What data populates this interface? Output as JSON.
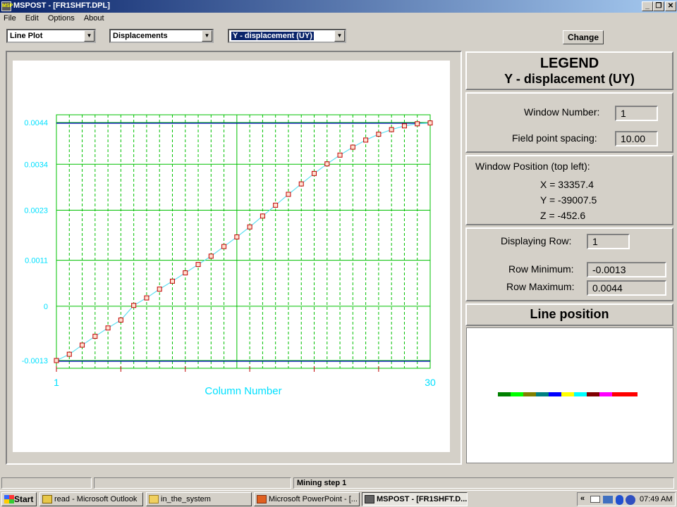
{
  "window": {
    "title": "MSPOST - [FR1SHFT.DPL]",
    "icon_text": "MSP"
  },
  "menu": [
    "File",
    "Edit",
    "Options",
    "About"
  ],
  "toolbar": {
    "plot_type": "Line Plot",
    "result_type": "Displacements",
    "component": "Y - displacement (UY)",
    "change_label": "Change"
  },
  "chart_data": {
    "type": "line",
    "xlabel": "Column Number",
    "x_tick_labels": [
      "1",
      "30"
    ],
    "y_tick_labels": [
      "0.0044",
      "0.0034",
      "0.0023",
      "0.0011",
      "0",
      "-0.0013"
    ],
    "x": [
      1,
      2,
      3,
      4,
      5,
      6,
      7,
      8,
      9,
      10,
      11,
      12,
      13,
      14,
      15,
      16,
      17,
      18,
      19,
      20,
      21,
      22,
      23,
      24,
      25,
      26,
      27,
      28,
      29,
      30
    ],
    "values": [
      -0.0013,
      -0.00115,
      -0.00093,
      -0.00072,
      -0.00052,
      -0.00033,
      2e-05,
      0.0002,
      0.00041,
      0.0006,
      0.0008,
      0.001,
      0.0012,
      0.00143,
      0.00166,
      0.0019,
      0.00216,
      0.00242,
      0.00268,
      0.00293,
      0.00318,
      0.00341,
      0.00362,
      0.00381,
      0.00398,
      0.00412,
      0.00423,
      0.00432,
      0.00437,
      0.00439
    ],
    "ylim": [
      -0.0013,
      0.0044
    ],
    "xlim": [
      1,
      30
    ],
    "grid": true,
    "colors": {
      "line": "#60e0f0",
      "marker": "#c00000",
      "grid": "#00c000",
      "bound": "#0000c0",
      "label": "#00e0ff"
    }
  },
  "legend": {
    "title": "LEGEND",
    "subtitle": "Y - displacement (UY)",
    "window_number_label": "Window Number:",
    "window_number": "1",
    "spacing_label": "Field point spacing:",
    "spacing": "10.00",
    "position_label": "Window Position (top left):",
    "x": "X = 33357.4",
    "y": "Y = -39007.5",
    "z": "Z = -452.6",
    "row_label": "Displaying Row:",
    "row": "1",
    "min_label": "Row Minimum:",
    "min": "-0.0013",
    "max_label": "Row Maximum:",
    "max": "0.0044",
    "line_position_title": "Line position",
    "colorbar": [
      "#008000",
      "#00ff00",
      "#808000",
      "#008080",
      "#0000ff",
      "#ffff00",
      "#00ffff",
      "#800000",
      "#ff00ff",
      "#ff0000",
      "#ff0000"
    ]
  },
  "status": {
    "message": "Mining step 1"
  },
  "taskbar": {
    "start": "Start",
    "items": [
      "read - Microsoft Outlook",
      "in_the_system",
      "Microsoft PowerPoint - [...",
      "MSPOST - [FR1SHFT.D..."
    ],
    "clock": "07:49 AM"
  }
}
